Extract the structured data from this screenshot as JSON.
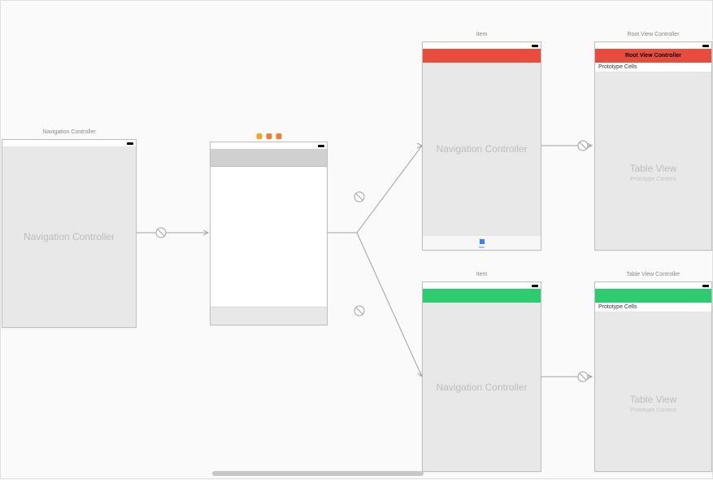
{
  "scenes": {
    "navLeft": {
      "header": "Navigation Controller",
      "bodyLabel": "Navigation Controller"
    },
    "tabVC": {
      "tabLabel": "Item"
    },
    "navTopRight": {
      "header": "Item",
      "bodyLabel": "Navigation Controller"
    },
    "navBottomRight": {
      "header": "Item",
      "bodyLabel": "Navigation Controller"
    },
    "tableTop": {
      "header": "Root View Controller",
      "navTitle": "Root View Controller",
      "protoLabel": "Prototype Cells",
      "bodyLabel": "Table View",
      "bodySub": "Prototype Content"
    },
    "tableBottom": {
      "header": "Table View Controller",
      "protoLabel": "Prototype Cells",
      "bodyLabel": "Table View",
      "bodySub": "Prototype Content"
    }
  }
}
